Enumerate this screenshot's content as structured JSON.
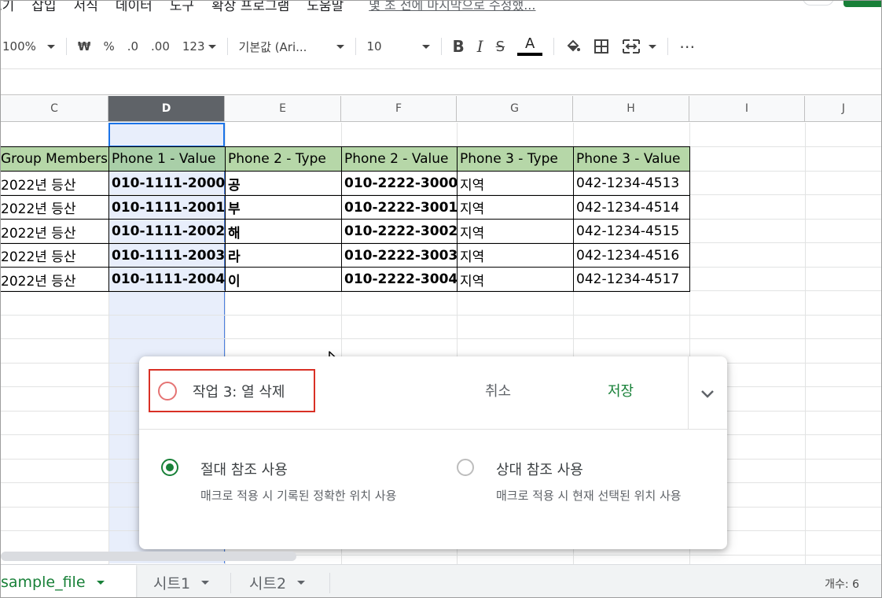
{
  "menu": {
    "items": [
      "보기",
      "삽입",
      "서식",
      "데이터",
      "도구",
      "확장 프로그램",
      "도움말"
    ],
    "last_edit": "몇 초 전에 마지막으로 수정했..."
  },
  "toolbar": {
    "zoom": "100%",
    "currency": "₩",
    "percent": "%",
    "decrease_decimal": ".0",
    "increase_decimal": ".00",
    "more_formats": "123",
    "font": "기본값 (Ari...",
    "font_size": "10",
    "bold": "B",
    "italic": "I",
    "strike": "S",
    "text_color": "A",
    "more": "⋯"
  },
  "columns": [
    "C",
    "D",
    "E",
    "F",
    "G",
    "H",
    "I",
    "J"
  ],
  "selected_column": "D",
  "table": {
    "headers": [
      "Group Members",
      "Phone 1 - Value",
      "Phone 2 - Type",
      "Phone 2 - Value",
      "Phone 3 - Type",
      "Phone 3 - Value"
    ],
    "rows": [
      [
        "2022년 등산",
        "010-1111-2000",
        "공",
        "010-2222-3000",
        "지역",
        "042-1234-4513"
      ],
      [
        "2022년 등산",
        "010-1111-2001",
        "부",
        "010-2222-3001",
        "지역",
        "042-1234-4514"
      ],
      [
        "2022년 등산",
        "010-1111-2002",
        "해",
        "010-2222-3002",
        "지역",
        "042-1234-4515"
      ],
      [
        "2022년 등산",
        "010-1111-2003",
        "라",
        "010-2222-3003",
        "지역",
        "042-1234-4516"
      ],
      [
        "2022년 등산",
        "010-1111-2004",
        "이",
        "010-2222-3004",
        "지역",
        "042-1234-4517"
      ]
    ]
  },
  "macro_dialog": {
    "name": "작업 3: 열 삭제",
    "cancel_label": "취소",
    "save_label": "저장",
    "options": [
      {
        "title": "절대 참조 사용",
        "desc": "매크로 적용 시 기록된 정확한 위치 사용",
        "selected": true
      },
      {
        "title": "상대 참조 사용",
        "desc": "매크로 적용 시 현재 선택된 위치 사용",
        "selected": false
      }
    ]
  },
  "sheets": {
    "tabs": [
      "sample_file",
      "시트1",
      "시트2"
    ],
    "active": "sample_file",
    "count_label": "개수: 6"
  },
  "colors": {
    "header_fill": "#b6d7a8",
    "selection": "#e8eefb",
    "accent_green": "#188038",
    "highlight_red": "#d93025"
  }
}
